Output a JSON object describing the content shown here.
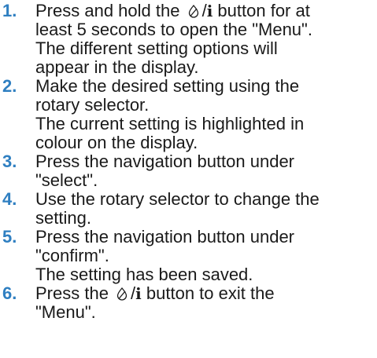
{
  "steps": [
    {
      "number": "1.",
      "lines": [
        {
          "pre": "Press and hold the ",
          "icon": "water-drop-icon",
          "after_icon": "/",
          "info": "i",
          "post": " button for at"
        },
        {
          "text": "least 5 seconds to open the \"Menu\"."
        },
        {
          "text": "The different setting options will"
        },
        {
          "text": "appear in the display."
        }
      ]
    },
    {
      "number": "2.",
      "lines": [
        {
          "text": "Make the desired setting using the"
        },
        {
          "text": "rotary selector."
        },
        {
          "text": "The current setting is highlighted in"
        },
        {
          "text": "colour on the display."
        }
      ]
    },
    {
      "number": "3.",
      "lines": [
        {
          "text": "Press the navigation button under"
        },
        {
          "text": "\"select\"."
        }
      ]
    },
    {
      "number": "4.",
      "lines": [
        {
          "text": "Use the rotary selector to change the"
        },
        {
          "text": "setting."
        }
      ]
    },
    {
      "number": "5.",
      "lines": [
        {
          "text": "Press the navigation button under"
        },
        {
          "text": "\"confirm\"."
        },
        {
          "text": "The setting has been saved."
        }
      ]
    },
    {
      "number": "6.",
      "lines": [
        {
          "pre": "Press the ",
          "icon": "water-drop-icon",
          "after_icon": "/",
          "info": "i",
          "post": " button to exit the"
        },
        {
          "text": "\"Menu\"."
        }
      ]
    }
  ],
  "colors": {
    "step_number": "#2f7fc1",
    "text": "#1a1a1a"
  }
}
